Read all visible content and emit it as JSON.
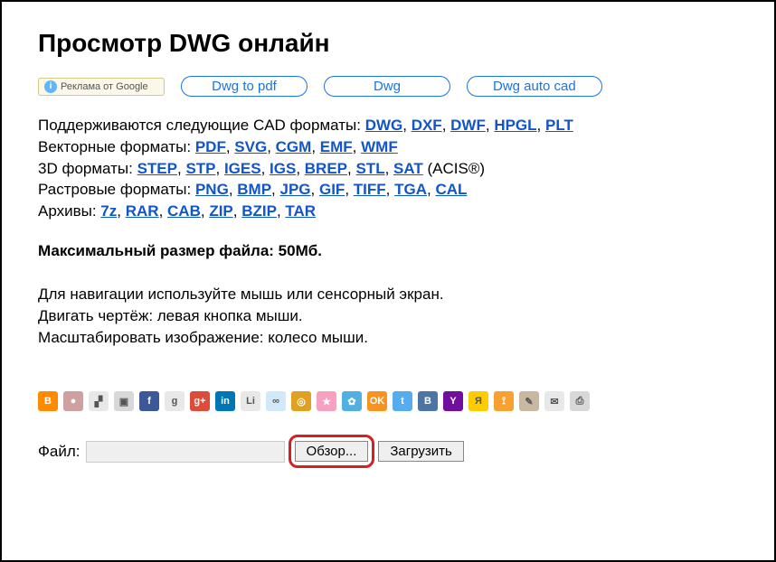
{
  "title": "Просмотр DWG онлайн",
  "adBadge": {
    "label": "Реклама от Google"
  },
  "adPills": [
    "Dwg to pdf",
    "Dwg",
    "Dwg auto cad"
  ],
  "formats": {
    "cad": {
      "label": "Поддерживаются следующие CAD форматы: ",
      "items": [
        "DWG",
        "DXF",
        "DWF",
        "HPGL",
        "PLT"
      ]
    },
    "vector": {
      "label": "Векторные форматы: ",
      "items": [
        "PDF",
        "SVG",
        "CGM",
        "EMF",
        "WMF"
      ]
    },
    "three_d": {
      "label": "3D форматы: ",
      "items": [
        "STEP",
        "STP",
        "IGES",
        "IGS",
        "BREP",
        "STL",
        "SAT"
      ],
      "suffix": " (ACIS®)"
    },
    "raster": {
      "label": "Растровые форматы: ",
      "items": [
        "PNG",
        "BMP",
        "JPG",
        "GIF",
        "TIFF",
        "TGA",
        "CAL"
      ]
    },
    "archive": {
      "label": "Архивы: ",
      "items": [
        "7z",
        "RAR",
        "CAB",
        "ZIP",
        "BZIP",
        "TAR"
      ]
    }
  },
  "maxSize": "Максимальный размер файла: 50Мб.",
  "navHelp": [
    "Для навигации используйте мышь или сенсорный экран.",
    "Двигать чертёж: левая кнопка мыши.",
    "Масштабировать изображение: колесо мыши."
  ],
  "shareIcons": [
    {
      "name": "blogger",
      "bg": "#ff8a00",
      "txt": "B"
    },
    {
      "name": "reddit",
      "bg": "#cfa0a0",
      "txt": "●"
    },
    {
      "name": "delicious",
      "bg": "#e8e8e8",
      "txt": "▞"
    },
    {
      "name": "digg",
      "bg": "#d8d8d8",
      "txt": "▣"
    },
    {
      "name": "facebook",
      "bg": "#3b5998",
      "txt": "f"
    },
    {
      "name": "google",
      "bg": "#e8e8e8",
      "txt": "g"
    },
    {
      "name": "gplus",
      "bg": "#dd4b39",
      "txt": "g+"
    },
    {
      "name": "linkedin",
      "bg": "#0077b5",
      "txt": "in"
    },
    {
      "name": "livejournal",
      "bg": "#e8e8e8",
      "txt": "Li"
    },
    {
      "name": "chain",
      "bg": "#d0e8f8",
      "txt": "∞"
    },
    {
      "name": "myspace",
      "bg": "#e0a020",
      "txt": "◎"
    },
    {
      "name": "favorite",
      "bg": "#f8a0c0",
      "txt": "★"
    },
    {
      "name": "share",
      "bg": "#50b0e0",
      "txt": "✿"
    },
    {
      "name": "odnoklassniki",
      "bg": "#f7931e",
      "txt": "OK"
    },
    {
      "name": "twitter",
      "bg": "#55acee",
      "txt": "t"
    },
    {
      "name": "vk",
      "bg": "#4c75a3",
      "txt": "B"
    },
    {
      "name": "yahoo",
      "bg": "#720e9e",
      "txt": "Y"
    },
    {
      "name": "yandex",
      "bg": "#ffcc00",
      "txt": "Я"
    },
    {
      "name": "rss",
      "bg": "#f8a030",
      "txt": "⟟"
    },
    {
      "name": "post",
      "bg": "#c8b8a0",
      "txt": "✎"
    },
    {
      "name": "mail",
      "bg": "#e8e8e8",
      "txt": "✉"
    },
    {
      "name": "print",
      "bg": "#d8d8d8",
      "txt": "⎙"
    }
  ],
  "fileRow": {
    "label": "Файл:",
    "browse": "Обзор...",
    "upload": "Загрузить"
  }
}
